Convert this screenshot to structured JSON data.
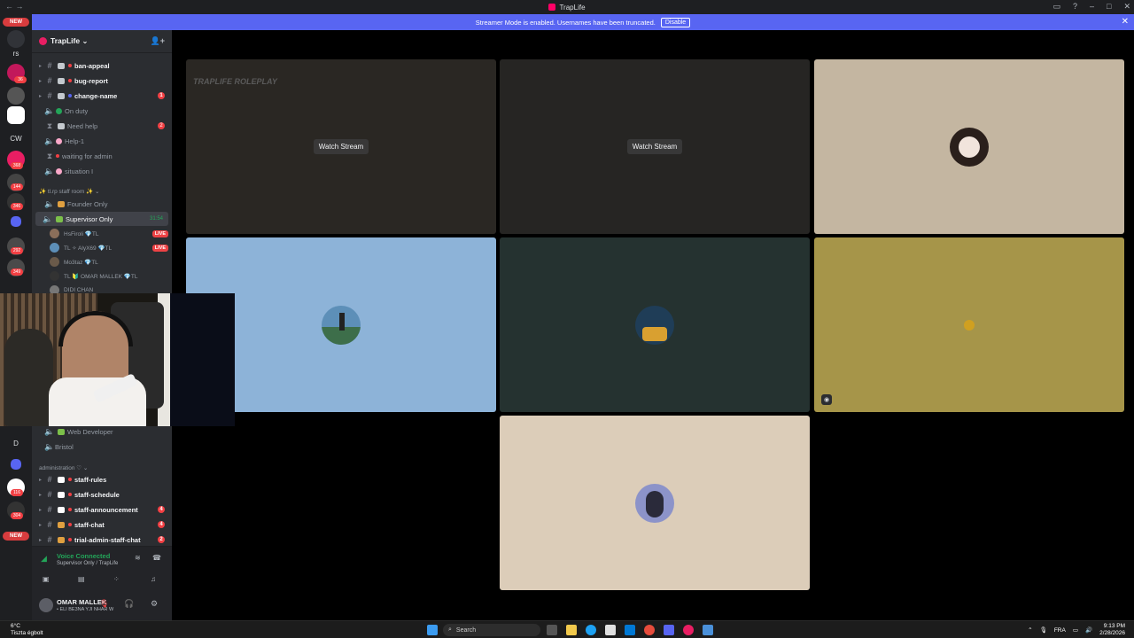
{
  "window": {
    "title": "TrapLife"
  },
  "banner": {
    "message": "Streamer Mode is enabled. Usernames have been truncated.",
    "disable_label": "Disable"
  },
  "rail": {
    "new_label": "NEW",
    "rs_label": "rs",
    "cw_label": "CW",
    "d_label": "D",
    "badges": [
      "36",
      "368",
      "144",
      "346",
      "292",
      "349",
      "116",
      "304"
    ]
  },
  "server": {
    "name": "TrapLife ⌄"
  },
  "channels": [
    {
      "name": "ban-appeal",
      "bold": true,
      "mention": ""
    },
    {
      "name": "bug-report",
      "bold": true,
      "mention": ""
    },
    {
      "name": "change-name",
      "bold": true,
      "mention": "1"
    },
    {
      "name": "On duty",
      "bold": false,
      "mention": ""
    },
    {
      "name": "Need help",
      "bold": false,
      "mention": "2"
    },
    {
      "name": "Help-1",
      "bold": false,
      "mention": ""
    },
    {
      "name": "waiting for admin",
      "bold": false,
      "mention": ""
    },
    {
      "name": "situation I",
      "bold": false,
      "mention": ""
    }
  ],
  "staff_category": "✨ tl.rp staff room ✨ ⌄",
  "founder_channel": "Founder Only",
  "supervisor_channel": {
    "name": "Supervisor Only",
    "timer": "31:54"
  },
  "voice_users": [
    {
      "name": "HsFiroli 💎TL",
      "live": "LIVE"
    },
    {
      "name": "TL ✧ AlyX69 💎TL",
      "live": "LIVE"
    },
    {
      "name": "Mo3taz 💎TL",
      "live": ""
    },
    {
      "name": "TL 🔰 OMAR MALLEK 💎TL",
      "live": ""
    },
    {
      "name": "DIDI CHAN",
      "live": ""
    }
  ],
  "lower_channels": {
    "web_dev": "Web Developer",
    "bristol": "Bristol"
  },
  "admin_category": "administration ♡ ⌄",
  "admin_channels": [
    {
      "name": "staff-rules",
      "mention": ""
    },
    {
      "name": "staff-schedule",
      "mention": ""
    },
    {
      "name": "staff-announcement",
      "mention": "4"
    },
    {
      "name": "staff-chat",
      "mention": "4"
    },
    {
      "name": "trial-admin-staff-chat",
      "mention": "2"
    }
  ],
  "voice_connected": {
    "title": "Voice Connected",
    "subtitle": "Supervisor Only / TrapLife"
  },
  "user": {
    "name": "OMAR MALLEK",
    "status": "• ELI BE3NA YJI NHAR W"
  },
  "stage": {
    "watch_label": "Watch Stream",
    "stream_caption": "TRAPLIFE ROLEPLAY",
    "tiles": [
      {
        "bg": "#2a2723",
        "kind": "stream"
      },
      {
        "bg": "#262523",
        "kind": "stream"
      },
      {
        "bg": "#c4b6a1",
        "kind": "avatar",
        "avatar_bg": "#2a1f1b"
      },
      {
        "bg": "#8db3d8",
        "kind": "avatar",
        "avatar_bg": "#5d8fb8"
      },
      {
        "bg": "#253230",
        "kind": "avatar",
        "avatar_bg": "#1f3d57"
      },
      {
        "bg": "#a69549",
        "kind": "avatar-small",
        "avatar_bg": "#d0a020"
      },
      {
        "bg": "#dccdb9",
        "kind": "avatar",
        "avatar_bg": "#8c93c9"
      }
    ]
  },
  "taskbar": {
    "weather_temp": "6°C",
    "weather_desc": "Tiszta égbolt",
    "search_placeholder": "Search",
    "lang": "FRA",
    "time": "9:13 PM",
    "date": "2/28/2026"
  },
  "colors": {
    "blurple": "#5865f2",
    "green": "#23a559",
    "red": "#f23f43"
  }
}
